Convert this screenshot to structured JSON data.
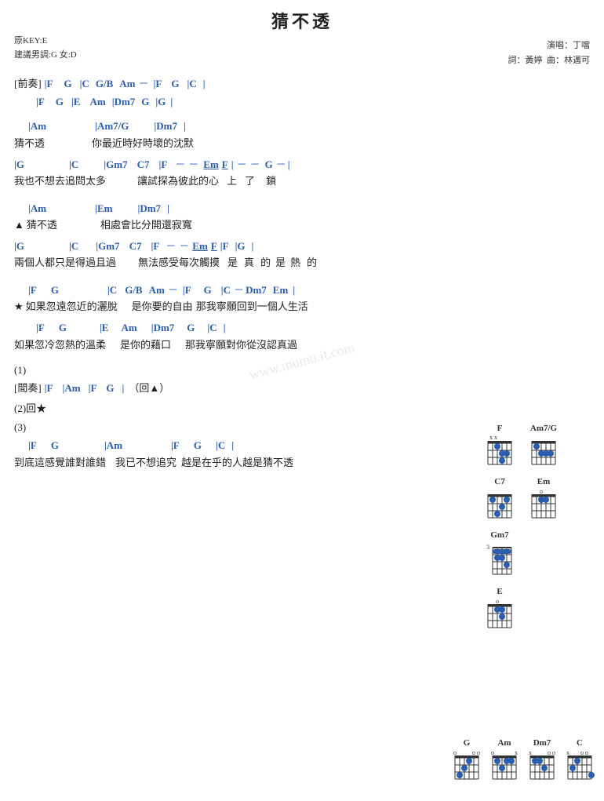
{
  "header": {
    "title": "猜不透",
    "key_original": "原KEY:E",
    "key_suggest": "建議男調:G 女:D",
    "singer_label": "演唱：丁噹",
    "lyric_label": "詞：黃婷",
    "compose_label": "曲：林邁可"
  },
  "watermark": "www.mumu.it.com",
  "sections": {
    "prelude_label": "[前奏]",
    "interlude_label": "[間奏]",
    "section1_label": "(1)",
    "section2_label": "(2)回★",
    "section3_label": "(3)"
  },
  "chord_diagrams": {
    "F": "F",
    "Am7G": "Am7/G",
    "C7": "C7",
    "Em": "Em",
    "Gm7": "Gm7",
    "E": "E",
    "G": "G",
    "Am": "Am",
    "Dm7": "Dm7",
    "C": "C"
  }
}
